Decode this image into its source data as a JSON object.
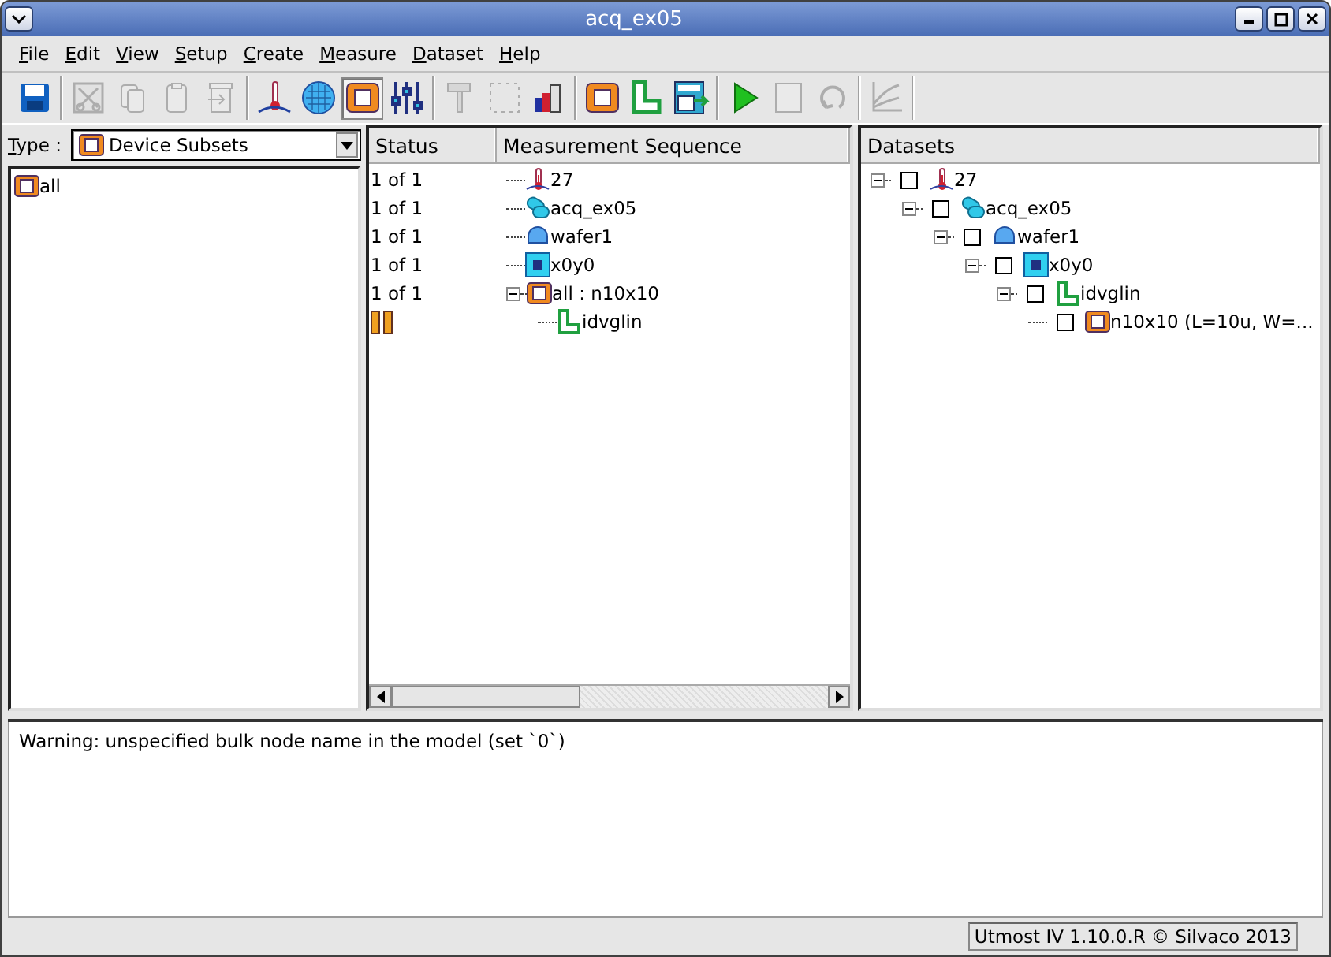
{
  "window": {
    "title": "acq_ex05"
  },
  "menu": [
    "File",
    "Edit",
    "View",
    "Setup",
    "Create",
    "Measure",
    "Dataset",
    "Help"
  ],
  "toolbar": [
    [
      {
        "disabled": false,
        "selected": false
      }
    ],
    [
      {
        "disabled": true,
        "selected": false
      },
      {
        "disabled": true,
        "selected": false
      },
      {
        "disabled": true,
        "selected": false
      },
      {
        "disabled": true,
        "selected": false
      }
    ],
    [
      {
        "disabled": false,
        "selected": false
      },
      {
        "disabled": false,
        "selected": false
      },
      {
        "disabled": false,
        "selected": true
      },
      {
        "disabled": false,
        "selected": false
      }
    ],
    [
      {
        "disabled": true,
        "selected": false
      },
      {
        "disabled": true,
        "selected": false
      },
      {
        "disabled": false,
        "selected": false
      }
    ],
    [
      {
        "disabled": false,
        "selected": false
      },
      {
        "disabled": false,
        "selected": false
      },
      {
        "disabled": false,
        "selected": false
      }
    ],
    [
      {
        "disabled": false,
        "selected": false
      },
      {
        "disabled": true,
        "selected": false
      },
      {
        "disabled": true,
        "selected": false
      }
    ],
    [
      {
        "disabled": true,
        "selected": false
      }
    ]
  ],
  "device_panel": {
    "type_label": "Type :",
    "type_value": "Device Subsets",
    "items": [
      {
        "kind": "device",
        "label": "all"
      }
    ]
  },
  "sequence": {
    "columns": [
      "Status",
      "Measurement Sequence"
    ],
    "items": [
      {
        "kind": "temperature",
        "label": "27",
        "status": "1 of 1"
      },
      {
        "kind": "wafer-lot",
        "label": "acq_ex05",
        "status": "1 of 1"
      },
      {
        "kind": "wafer",
        "label": "wafer1",
        "status": "1 of 1"
      },
      {
        "kind": "die",
        "label": "x0y0",
        "status": "1 of 1"
      },
      {
        "kind": "device",
        "label": "all : n10x10",
        "status": "1 of 1",
        "expanded": true,
        "children": [
          {
            "kind": "test",
            "label": "idvglin",
            "paused": true
          }
        ]
      }
    ]
  },
  "datasets": {
    "title": "Datasets",
    "items": [
      {
        "kind": "temperature",
        "label": "27",
        "expanded": true,
        "checked": false,
        "children": [
          {
            "kind": "wafer-lot",
            "label": "acq_ex05",
            "expanded": true,
            "checked": false,
            "children": [
              {
                "kind": "wafer",
                "label": "wafer1",
                "expanded": true,
                "checked": false,
                "children": [
                  {
                    "kind": "die",
                    "label": "x0y0",
                    "expanded": true,
                    "checked": false,
                    "children": [
                      {
                        "kind": "test",
                        "label": "idvglin",
                        "expanded": true,
                        "checked": false,
                        "children": [
                          {
                            "kind": "device",
                            "label": "n10x10 (L=10u, W=...",
                            "checked": false
                          }
                        ]
                      }
                    ]
                  }
                ]
              }
            ]
          }
        ]
      }
    ]
  },
  "log": {
    "lines": [
      "Warning: unspecified bulk node name in the model (set `0`)"
    ]
  },
  "status_bar": "Utmost IV 1.10.0.R © Silvaco 2013"
}
